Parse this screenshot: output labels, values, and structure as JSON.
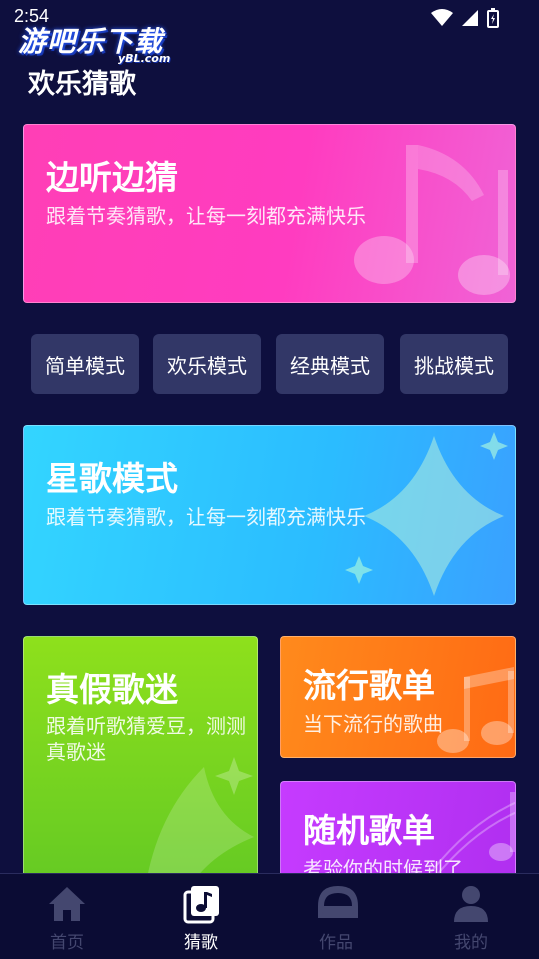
{
  "status_bar": {
    "time": "2:54"
  },
  "watermark": {
    "text": "游吧乐下载",
    "sub": "yBL.com"
  },
  "page": {
    "title": "欢乐猜歌"
  },
  "cards": {
    "listen_guess": {
      "title": "边听边猜",
      "subtitle": "跟着节奏猜歌，让每一刻都充满快乐"
    },
    "star_song": {
      "title": "星歌模式",
      "subtitle": "跟着节奏猜歌，让每一刻都充满快乐"
    },
    "true_fan": {
      "title": "真假歌迷",
      "subtitle": "跟着听歌猜爱豆，测测真歌迷"
    },
    "popular": {
      "title": "流行歌单",
      "subtitle": "当下流行的歌曲"
    },
    "random": {
      "title": "随机歌单",
      "subtitle": "考验你的时候到了"
    }
  },
  "modes": [
    "简单模式",
    "欢乐模式",
    "经典模式",
    "挑战模式"
  ],
  "nav": {
    "items": [
      {
        "label": "首页",
        "icon": "home-icon",
        "active": false
      },
      {
        "label": "猜歌",
        "icon": "music-note-icon",
        "active": true
      },
      {
        "label": "作品",
        "icon": "works-icon",
        "active": false
      },
      {
        "label": "我的",
        "icon": "user-icon",
        "active": false
      }
    ]
  },
  "colors": {
    "background": "#0e0f3e",
    "active_nav": "#ffffff",
    "inactive_nav": "#44476f"
  }
}
